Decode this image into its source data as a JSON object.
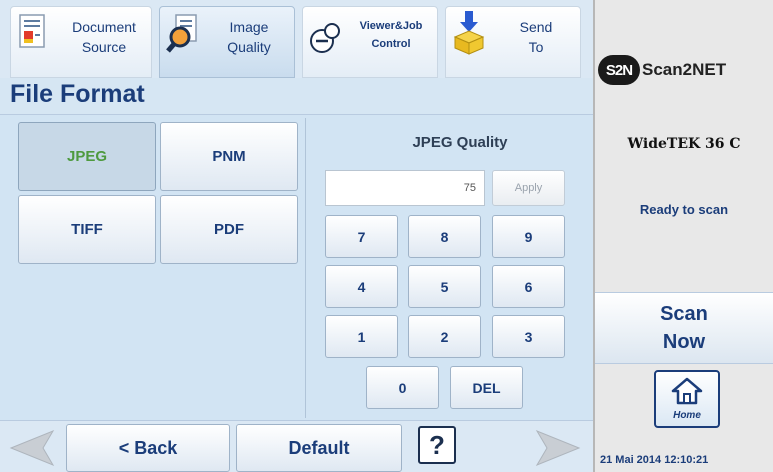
{
  "toolbar": {
    "document_source": [
      "Document",
      "Source"
    ],
    "image_quality": [
      "Image",
      "Quality"
    ],
    "viewer_job": [
      "Viewer&Job",
      "Control"
    ],
    "send_to": [
      "Send",
      "To"
    ]
  },
  "page_title": "File Format",
  "formats": [
    "JPEG",
    "PNM",
    "TIFF",
    "PDF"
  ],
  "selected_format": "JPEG",
  "quality": {
    "title": "JPEG Quality",
    "value": "75",
    "apply_label": "Apply"
  },
  "keypad": [
    "7",
    "8",
    "9",
    "4",
    "5",
    "6",
    "1",
    "2",
    "3",
    "0",
    "DEL"
  ],
  "bottom": {
    "back_label": "< Back",
    "default_label": "Default",
    "help_label": "?"
  },
  "side": {
    "logo_mark": "S2N",
    "logo_text": "Scan2NET",
    "device_name": "WideTEK 36 C",
    "status": "Ready to scan",
    "scan_now": [
      "Scan",
      "Now"
    ],
    "home_label": "Home",
    "datetime": "21 Mai 2014 12:10:21"
  },
  "colors": {
    "accent": "#1b3d7a",
    "selected_text": "#4e9a3f",
    "panel_bg": "#d2e4f3"
  },
  "icons": [
    "document-icon",
    "magnifier-icon",
    "viewer-icon",
    "send-box-icon",
    "arrow-left-icon",
    "arrow-right-icon",
    "home-icon"
  ]
}
